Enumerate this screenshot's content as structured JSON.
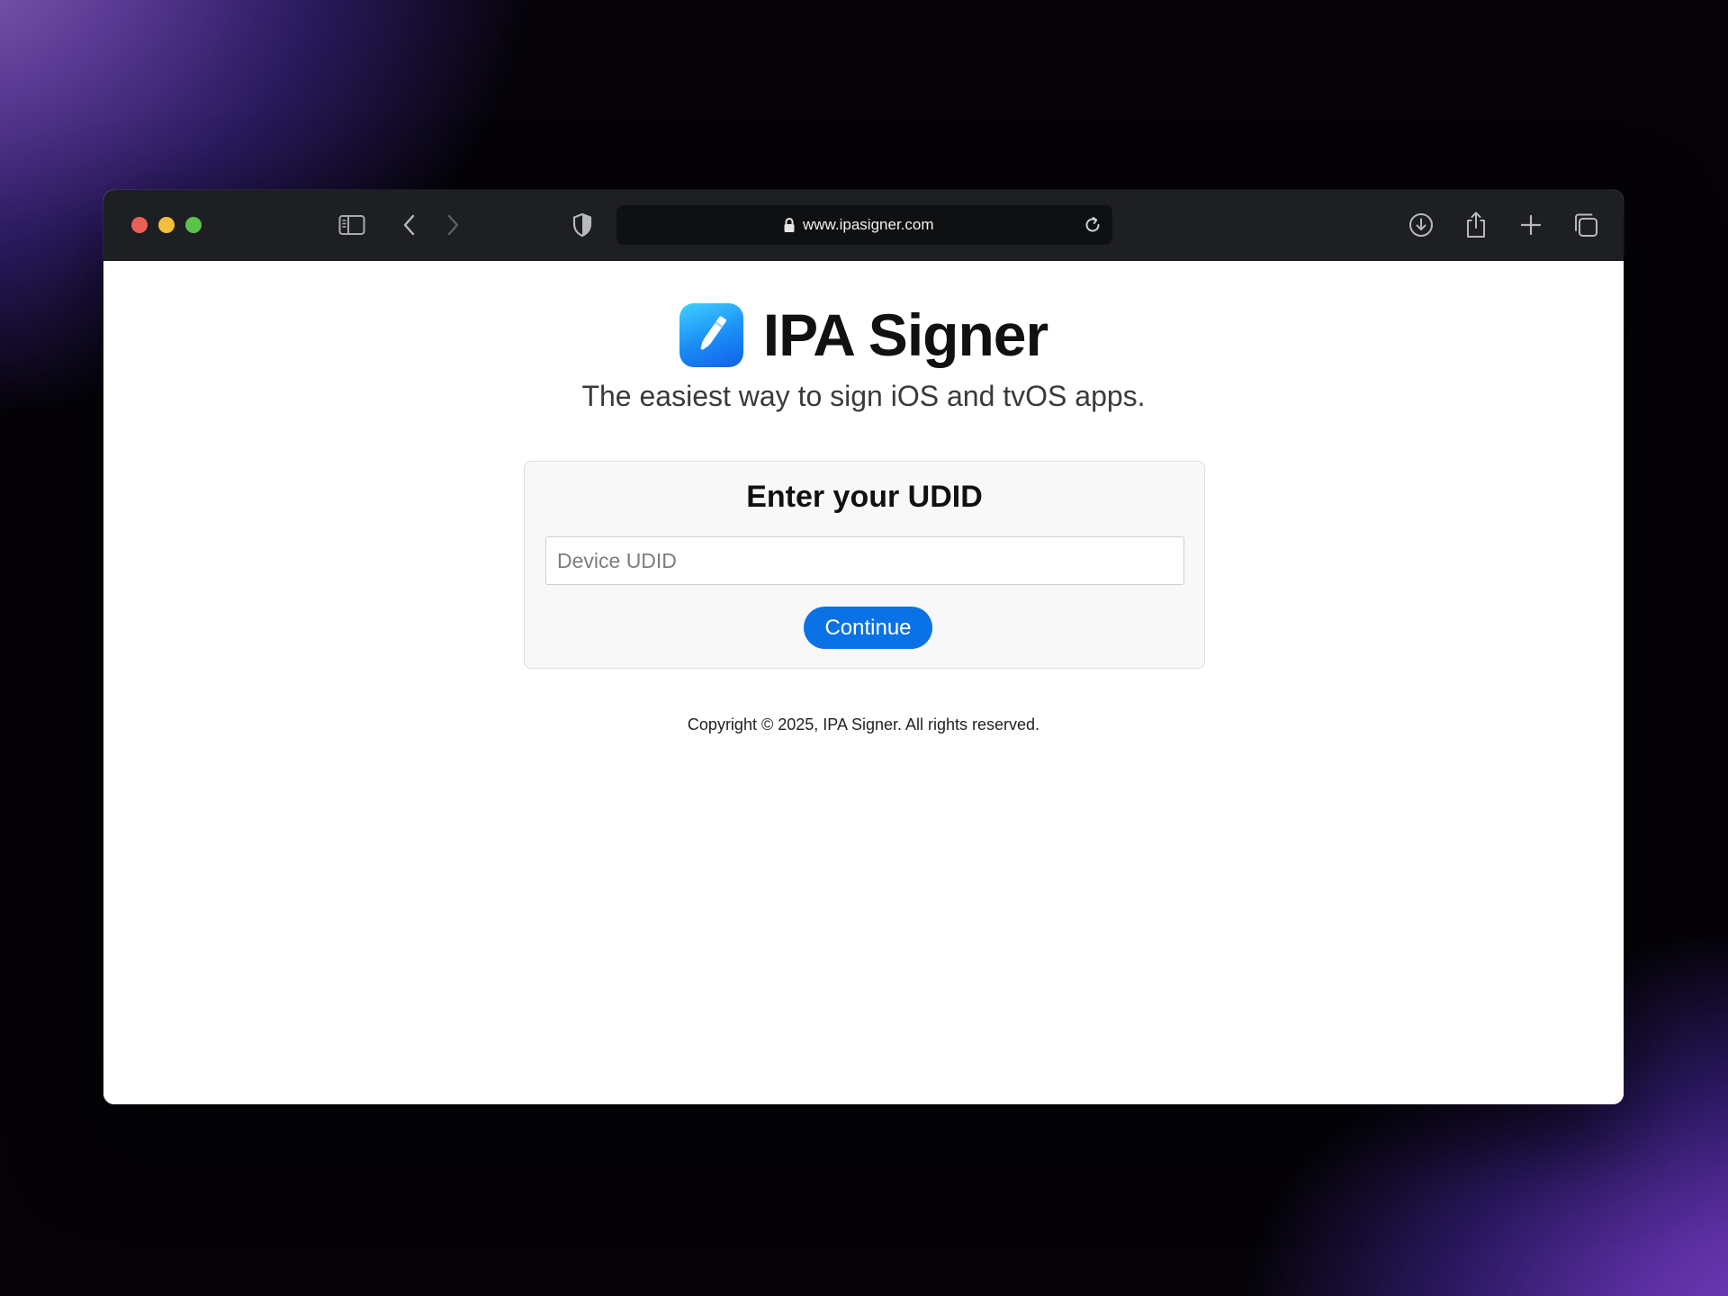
{
  "browser": {
    "url": "www.ipasigner.com",
    "traffic_lights": {
      "close_color": "#ec5f57",
      "minimize_color": "#f4be3c",
      "zoom_color": "#5ac448"
    },
    "toolbar_icons": [
      "sidebar-icon",
      "back-icon",
      "forward-icon",
      "privacy-shield-icon",
      "lock-icon",
      "reload-icon",
      "download-icon",
      "share-icon",
      "new-tab-icon",
      "tab-overview-icon"
    ]
  },
  "page": {
    "brand": {
      "title": "IPA Signer",
      "icon": "pen-app-icon"
    },
    "tagline": "The easiest way to sign iOS and tvOS apps.",
    "form": {
      "title": "Enter your UDID",
      "udid_placeholder": "Device UDID",
      "udid_value": "",
      "continue_label": "Continue"
    },
    "footer": {
      "copyright": "Copyright © 2025, IPA Signer. All rights reserved."
    }
  },
  "colors": {
    "accent": "#0b72e5",
    "toolbar_bg": "#1e1f22",
    "card_bg": "#f8f8f8"
  }
}
